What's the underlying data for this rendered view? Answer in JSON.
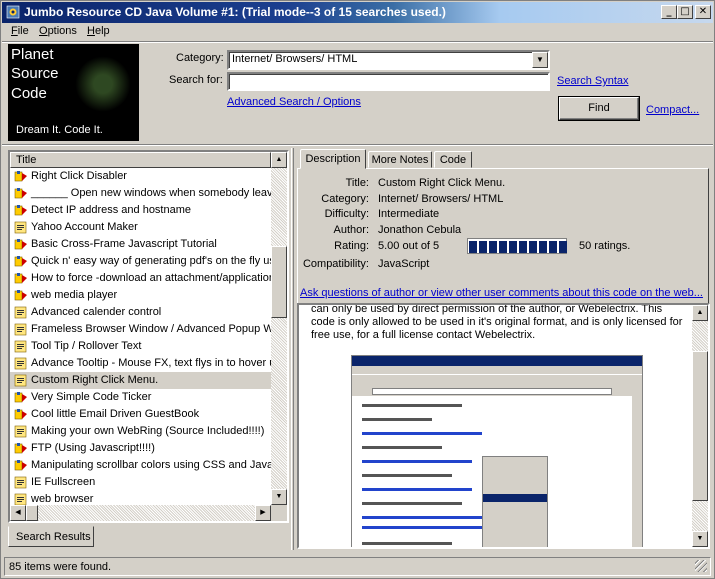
{
  "window": {
    "title": "Jumbo Resource CD Java Volume #1: (Trial mode--3 of 15 searches used.)",
    "controls": [
      "_",
      "□",
      "✕"
    ]
  },
  "menu": {
    "items": [
      {
        "label": "File",
        "key": "F",
        "rest": "ile"
      },
      {
        "label": "Options",
        "key": "O",
        "rest": "ptions"
      },
      {
        "label": "Help",
        "key": "H",
        "rest": "elp"
      }
    ]
  },
  "logo": {
    "line1": "Planet",
    "line2": "Source",
    "line3": "Code",
    "tagline": "Dream It.  Code It."
  },
  "search": {
    "category_label": "Category:",
    "category_value": "Internet/ Browsers/ HTML",
    "search_for_label": "Search for:",
    "search_for_value": "",
    "syntax_link": "Search Syntax",
    "advanced_link": "Advanced Search / Options",
    "find_label": "Find",
    "compact_link": "Compact..."
  },
  "results": {
    "column_title": "Title",
    "selected_index": 12,
    "items": [
      {
        "title": "Right Click Disabler",
        "icon": "javascript-icon"
      },
      {
        "title": "______ Open new windows when somebody leave",
        "icon": "javascript-icon"
      },
      {
        "title": "Detect IP address and hostname",
        "icon": "javascript-icon"
      },
      {
        "title": "Yahoo Account Maker",
        "icon": "script-icon"
      },
      {
        "title": "Basic Cross-Frame Javascript Tutorial",
        "icon": "javascript-icon"
      },
      {
        "title": "Quick n' easy way of generating pdf's on the fly usi",
        "icon": "javascript-icon"
      },
      {
        "title": "How to force -download an attachment/applicatior",
        "icon": "javascript-icon"
      },
      {
        "title": "web media player",
        "icon": "javascript-icon"
      },
      {
        "title": "Advanced calender control",
        "icon": "script-icon"
      },
      {
        "title": "Frameless Browser Window / Advanced Popup W",
        "icon": "script-icon"
      },
      {
        "title": "Tool Tip / Rollover Text",
        "icon": "script-icon"
      },
      {
        "title": "Advance Tooltip - Mouse FX, text flys in to hover u",
        "icon": "script-icon"
      },
      {
        "title": "Custom Right Click Menu.",
        "icon": "script-icon"
      },
      {
        "title": "Very Simple Code Ticker",
        "icon": "javascript-icon"
      },
      {
        "title": "Cool little Email Driven GuestBook",
        "icon": "javascript-icon"
      },
      {
        "title": "Making your own WebRing (Source Included!!!!)",
        "icon": "script-icon"
      },
      {
        "title": "FTP (Using Javascript!!!!)",
        "icon": "javascript-icon"
      },
      {
        "title": "Manipulating scrollbar colors using CSS and JavaS",
        "icon": "javascript-icon"
      },
      {
        "title": "IE Fullscreen",
        "icon": "script-icon"
      },
      {
        "title": "web browser",
        "icon": "script-icon"
      }
    ],
    "bottom_tab": "Search Results"
  },
  "tabs": {
    "description": "Description",
    "more_notes": "More Notes",
    "code": "Code"
  },
  "details": {
    "title_label": "Title:",
    "title_value": "Custom Right Click Menu.",
    "category_label": "Category:",
    "category_value": "Internet/ Browsers/ HTML",
    "difficulty_label": "Difficulty:",
    "difficulty_value": "Intermediate",
    "author_label": "Author:",
    "author_value": "Jonathon Cebula",
    "rating_label": "Rating:",
    "rating_value": "5.00 out of 5",
    "rating_fraction": 1.0,
    "rating_count": "50 ratings.",
    "compat_label": "Compatibility:",
    "compat_value": "JavaScript",
    "ask_link": "Ask questions of author or view other user comments about this code on the web..."
  },
  "content": {
    "text": "can only be used by direct permission of the author, or Webelectrix. This code is only allowed to be used in it's original format, and is only licensed for free use, for a full license contact Webelectrix."
  },
  "status": {
    "text": "85 items were found."
  },
  "colors": {
    "title_active": "#0a246a",
    "link": "#0000cc",
    "face": "#d4d0c8"
  }
}
